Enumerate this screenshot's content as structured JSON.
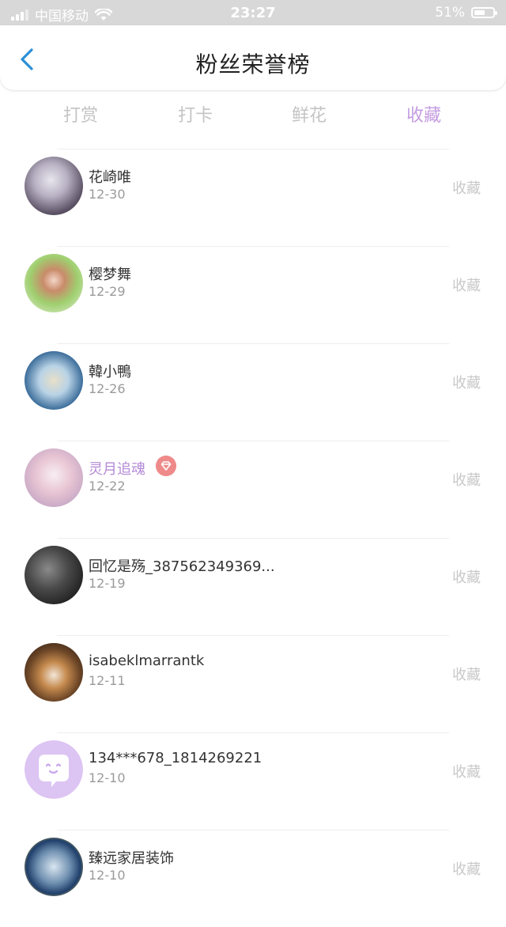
{
  "status_bar": {
    "carrier": "中国移动",
    "time": "23:27",
    "battery": "51%"
  },
  "header": {
    "title": "粉丝荣誉榜"
  },
  "tabs": [
    "打赏",
    "打卡",
    "鲜花",
    "收藏"
  ],
  "active_tab": "收藏",
  "list": [
    {
      "name": "花崎唯",
      "date": "12-30",
      "action": "收藏"
    },
    {
      "name": "樱梦舞",
      "date": "12-29",
      "action": "收藏"
    },
    {
      "name": "韓小鴨",
      "date": "12-26",
      "action": "收藏"
    },
    {
      "name": "灵月追魂",
      "date": "12-22",
      "action": "收藏",
      "vip": true
    },
    {
      "name": "回忆是殇_387562349369...",
      "date": "12-19",
      "action": "收藏"
    },
    {
      "name": "isabeklmarrantk",
      "date": "12-11",
      "action": "收藏"
    },
    {
      "name": "134***678_1814269221",
      "date": "12-10",
      "action": "收藏"
    },
    {
      "name": "臻远家居装饰",
      "date": "12-10",
      "action": "收藏"
    }
  ]
}
